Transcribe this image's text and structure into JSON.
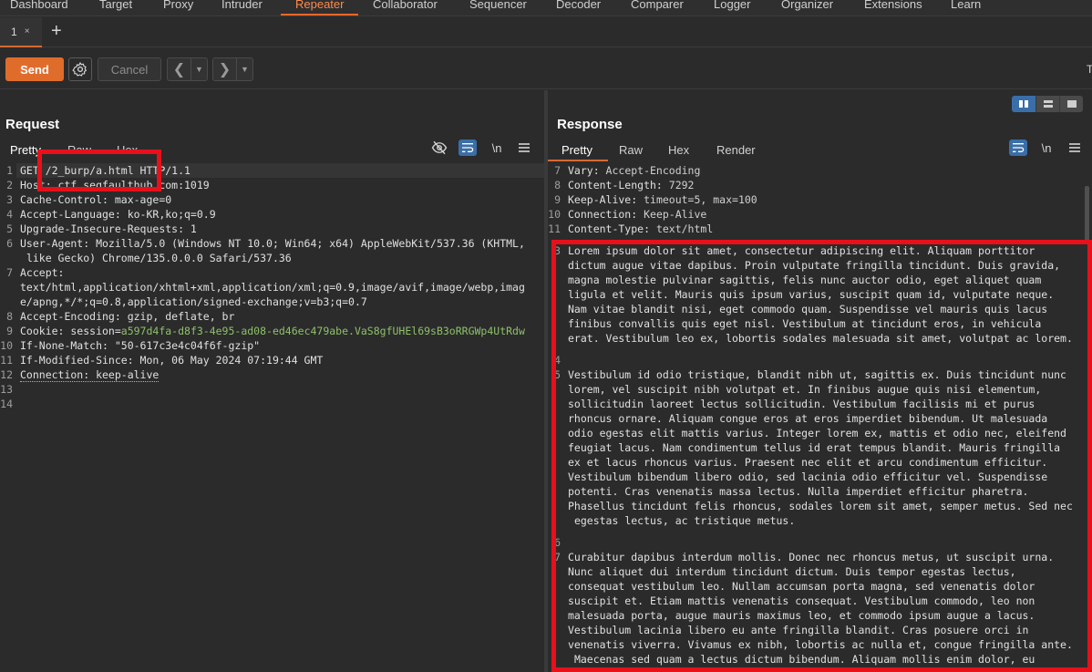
{
  "nav": {
    "tabs": [
      "Dashboard",
      "Target",
      "Proxy",
      "Intruder",
      "Repeater",
      "Collaborator",
      "Sequencer",
      "Decoder",
      "Comparer",
      "Logger",
      "Organizer",
      "Extensions",
      "Learn"
    ],
    "active": "Repeater"
  },
  "repeater_tab": {
    "number": "1",
    "close": "×",
    "add": "+"
  },
  "toolbar": {
    "send": "Send",
    "cancel": "Cancel",
    "edge_text": "T"
  },
  "request": {
    "title": "Request",
    "tabs": [
      "Pretty",
      "Raw",
      "Hex"
    ],
    "newline_label": "\\n",
    "lines": [
      {
        "n": "1",
        "text": "GET /2_burp/a.html HTTP/1.1"
      },
      {
        "n": "2",
        "text": "Host: ctf.segfaulthub.com:1019"
      },
      {
        "n": "3",
        "text": "Cache-Control: max-age=0"
      },
      {
        "n": "4",
        "text": "Accept-Language: ko-KR,ko;q=0.9"
      },
      {
        "n": "5",
        "text": "Upgrade-Insecure-Requests: 1"
      },
      {
        "n": "6",
        "text": "User-Agent: Mozilla/5.0 (Windows NT 10.0; Win64; x64) AppleWebKit/537.36 (KHTML,\n like Gecko) Chrome/135.0.0.0 Safari/537.36"
      },
      {
        "n": "7",
        "text": "Accept:\ntext/html,application/xhtml+xml,application/xml;q=0.9,image/avif,image/webp,imag\ne/apng,*/*;q=0.8,application/signed-exchange;v=b3;q=0.7"
      },
      {
        "n": "8",
        "text": "Accept-Encoding: gzip, deflate, br"
      },
      {
        "n": "9",
        "text": "Cookie: session=",
        "cookie_value": "a597d4fa-d8f3-4e95-ad08-ed46ec479abe.VaS8gfUHEl69sB3oRRGWp4UtRdw"
      },
      {
        "n": "10",
        "text": "If-None-Match: \"50-617c3e4c04f6f-gzip\""
      },
      {
        "n": "11",
        "text": "If-Modified-Since: Mon, 06 May 2024 07:19:44 GMT"
      },
      {
        "n": "12",
        "text": "Connection: keep-alive"
      },
      {
        "n": "13",
        "text": ""
      },
      {
        "n": "14",
        "text": ""
      }
    ]
  },
  "response": {
    "title": "Response",
    "tabs": [
      "Pretty",
      "Raw",
      "Hex",
      "Render"
    ],
    "newline_label": "\\n",
    "header_lines": [
      {
        "n": "7",
        "key": "Vary:",
        "val": " Accept-Encoding"
      },
      {
        "n": "8",
        "key": "Content-Length:",
        "val": " 7292"
      },
      {
        "n": "9",
        "key": "Keep-Alive:",
        "val": " timeout=5, max=100"
      },
      {
        "n": "10",
        "key": "Connection:",
        "val": " Keep-Alive"
      },
      {
        "n": "11",
        "key": "Content-Type:",
        "val": " text/html"
      }
    ],
    "body_lines": [
      {
        "n": "",
        "text": ""
      },
      {
        "n": "3",
        "text": "Lorem ipsum dolor sit amet, consectetur adipiscing elit. Aliquam porttitor\ndictum augue vitae dapibus. Proin vulputate fringilla tincidunt. Duis gravida,\nmagna molestie pulvinar sagittis, felis nunc auctor odio, eget aliquet quam\nligula et velit. Mauris quis ipsum varius, suscipit quam id, vulputate neque.\nNam vitae blandit nisi, eget commodo quam. Suspendisse vel mauris quis lacus\nfinibus convallis quis eget nisl. Vestibulum at tincidunt eros, in vehicula\nerat. Vestibulum leo ex, lobortis sodales malesuada sit amet, volutpat ac lorem."
      },
      {
        "n": "",
        "text": ""
      },
      {
        "n": "4",
        "text": ""
      },
      {
        "n": "5",
        "text": "Vestibulum id odio tristique, blandit nibh ut, sagittis ex. Duis tincidunt nunc\nlorem, vel suscipit nibh volutpat et. In finibus augue quis nisi elementum,\nsollicitudin laoreet lectus sollicitudin. Vestibulum facilisis mi et purus\nrhoncus ornare. Aliquam congue eros at eros imperdiet bibendum. Ut malesuada\nodio egestas elit mattis varius. Integer lorem ex, mattis et odio nec, eleifend\nfeugiat lacus. Nam condimentum tellus id erat tempus blandit. Mauris fringilla\nex et lacus rhoncus varius. Praesent nec elit et arcu condimentum efficitur.\nVestibulum bibendum libero odio, sed lacinia odio efficitur vel. Suspendisse\npotenti. Cras venenatis massa lectus. Nulla imperdiet efficitur pharetra.\nPhasellus tincidunt felis rhoncus, sodales lorem sit amet, semper metus. Sed nec\n egestas lectus, ac tristique metus."
      },
      {
        "n": "",
        "text": ""
      },
      {
        "n": "6",
        "text": ""
      },
      {
        "n": "7",
        "text": "Curabitur dapibus interdum mollis. Donec nec rhoncus metus, ut suscipit urna.\nNunc aliquet dui interdum tincidunt dictum. Duis tempor egestas lectus,\nconsequat vestibulum leo. Nullam accumsan porta magna, sed venenatis dolor\nsuscipit et. Etiam mattis venenatis consequat. Vestibulum commodo, leo non\nmalesuada porta, augue mauris maximus leo, et commodo ipsum augue a lacus.\nVestibulum lacinia libero eu ante fringilla blandit. Cras posuere orci in\nvenenatis viverra. Vivamus ex nibh, lobortis ac nulla et, congue fringilla ante.\n Maecenas sed quam a lectus dictum bibendum. Aliquam mollis enim dolor, eu"
      }
    ]
  },
  "colors": {
    "accent": "#e06c2c",
    "highlight_box": "#e8101a",
    "active_blue": "#3a6ea8",
    "cookie_value": "#8ec06a"
  }
}
